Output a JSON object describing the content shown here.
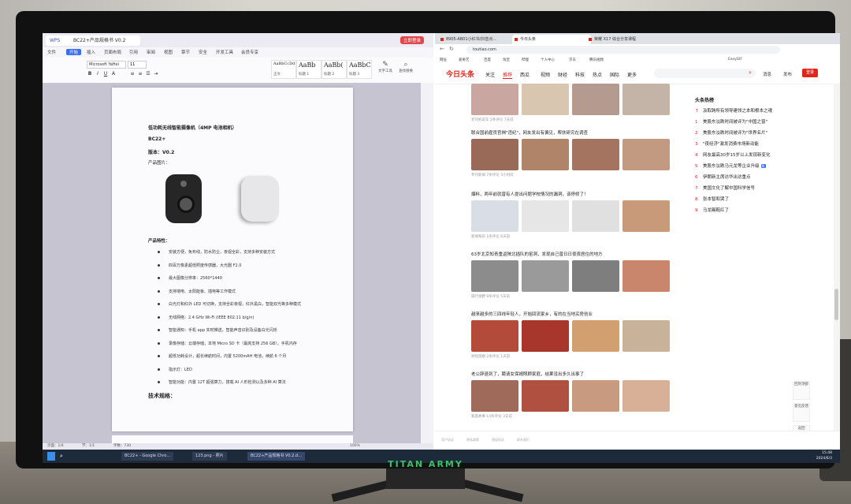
{
  "monitor": {
    "brand": "TITAN ARMY"
  },
  "wps": {
    "tabs": [
      {
        "label": "WPS"
      },
      {
        "label": "BC22+产品规格书 V0.2"
      }
    ],
    "login_label": "立即登录",
    "menu": [
      "文件",
      "开始",
      "插入",
      "页面布局",
      "引用",
      "审阅",
      "视图",
      "章节",
      "安全",
      "开发工具",
      "会员专享"
    ],
    "menu_active": "开始",
    "ribbon": {
      "font_name": "Microsoft YaHei",
      "font_size": "11",
      "styles": [
        {
          "sample": "AaBbCcDd",
          "name": "正文"
        },
        {
          "sample": "AaBb",
          "name": "标题 1"
        },
        {
          "sample": "AaBb(",
          "name": "标题 2"
        },
        {
          "sample": "AaBbC",
          "name": "标题 3"
        }
      ],
      "tools": [
        {
          "label": "文字工具"
        },
        {
          "label": "查找替换"
        }
      ]
    },
    "doc": {
      "title": "低功耗无线智能摄像机（4MP 电池相机）",
      "model": "BC22+",
      "version": "版本：V0.2",
      "pictures_label": "产品图片：",
      "features_label": "产品特性：",
      "features": [
        "安装方便，免布线，防水防尘，夜视全彩，支持多种安装方式",
        "四百万像素超低照度传感器，大光圈 F2.0",
        "最大图像分辨率：2560*1440",
        "支持墙电、太阳能板、插电等工作模式",
        "白光灯和红外 LED 可切换，支持全彩夜视，红外黑白，智能双光等多种模式",
        "无线网络：2.4 GHz Wi-Fi (IEEE 802.11 b/g/n)",
        "智能通知：手机 app 实时推送，智能声音识别及设备白光闪烁",
        "录像存储：云端存储，本地 Micro SD 卡（最高支持 256 GB），手机内存",
        "超低功耗设计，超长续航时间，内置 5200mAH 电池，续航 6 个月",
        "指示灯：LED",
        "智能功能：内置 12T 超强算力，搭载 AI 人形检测以及多种 AI 算法"
      ],
      "spec_label": "技术规格："
    },
    "status": {
      "page": "页面：1/4",
      "section": "节：1/1",
      "wordcount": "字数：730",
      "zoom": "100%"
    }
  },
  "browser": {
    "tabs": [
      {
        "label": "8905-AB01小红书/抖音点…"
      },
      {
        "label": "今日头条"
      },
      {
        "label": "荣耀 X17 综合分享课程"
      }
    ],
    "url": "toutiao.com",
    "bookmarks": [
      "网址",
      "爱奇艺",
      "百度",
      "淘宝",
      "哔哩",
      "个人中心",
      "京东",
      "腾讯视频",
      "EasyGIF"
    ],
    "toutiao": {
      "logo": "今日头条",
      "nav": [
        "关注",
        "推荐",
        "西瓜",
        "视频",
        "财经",
        "科技",
        "热点",
        "国际",
        "更多"
      ],
      "nav_active": "推荐",
      "messages_label": "消息",
      "post_label": "发布",
      "login_label": "登录",
      "articles": [
        {
          "title": "",
          "meta": "老司机说车  2条评论  7天前"
        },
        {
          "title": "联合国前雇员官揭\"违纪\"，网友发出有偏见，帮扶研究在调查",
          "meta": "专刊新闻  7条评论  3小时前"
        },
        {
          "title": "爆料，两年前就曾有人提出问题学校情况的漏洞，该停修了！",
          "meta": "新闻每日  1条评论  6天前"
        },
        {
          "title": "63岁北京知青重返陕北插队的窑洞，发现自己曾日日夜夜居住的地方",
          "meta": "旅行视野  8条评论  5天前"
        },
        {
          "title": "越来越多的三四线年轻人，开始回流家乡，有的在当地买房创业",
          "meta": "财经观察  2条评论  1天前"
        },
        {
          "title": "老公辞退到了，聘请女保姆照顾家庭，结果没出多久出事了",
          "meta": "家庭故事  14条评论  3天前"
        }
      ],
      "hot_title": "头条热榜",
      "hot": [
        {
          "rank": "↑",
          "text": "汲取跨所有领导建领之本和根本之魂"
        },
        {
          "rank": "1",
          "text": "美股东淡跌时间被评为\"中国之窗\""
        },
        {
          "rank": "2",
          "text": "美股东淡跌时间被评为\"世界名片\""
        },
        {
          "rank": "3",
          "text": "\"夜经济\"激发消费市场新动能"
        },
        {
          "rank": "4",
          "text": "网友最高30岁15岁以上发现新变化"
        },
        {
          "rank": "5",
          "text": "美股东淡跌马元龙等企业升级",
          "tag": "热"
        },
        {
          "rank": "6",
          "text": "伊朗新主席访华出访重点"
        },
        {
          "rank": "7",
          "text": "美国文化了解中国科学信号"
        },
        {
          "rank": "8",
          "text": "张本智和哭了"
        },
        {
          "rank": "9",
          "text": "马龙踢鞋红了"
        }
      ],
      "side": [
        "回到顶部",
        "意见反馈",
        "返回"
      ]
    },
    "footer": [
      "用户协议",
      "隐私政策",
      "侵权投诉",
      "联系我们"
    ]
  },
  "taskbar": {
    "items": [
      "BC22+ - Google Chro…",
      "123.png - 照片",
      "BC22+产品规格书 V0.2.d…"
    ],
    "time": "15:48",
    "date": "2024/6/3"
  }
}
